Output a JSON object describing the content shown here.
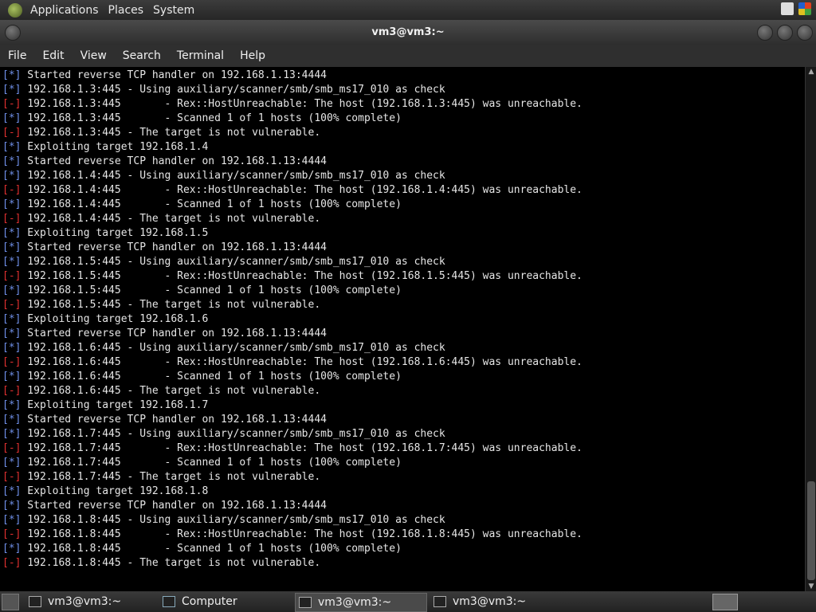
{
  "panel": {
    "menus": [
      "Applications",
      "Places",
      "System"
    ]
  },
  "window": {
    "title": "vm3@vm3:~"
  },
  "menubar": {
    "items": [
      "File",
      "Edit",
      "View",
      "Search",
      "Terminal",
      "Help"
    ]
  },
  "terminal": {
    "lines": [
      {
        "tag": "[*]",
        "text": " Started reverse TCP handler on 192.168.1.13:4444"
      },
      {
        "tag": "[*]",
        "text": " 192.168.1.3:445 - Using auxiliary/scanner/smb/smb_ms17_010 as check"
      },
      {
        "tag": "[-]",
        "text": " 192.168.1.3:445       - Rex::HostUnreachable: The host (192.168.1.3:445) was unreachable."
      },
      {
        "tag": "[*]",
        "text": " 192.168.1.3:445       - Scanned 1 of 1 hosts (100% complete)"
      },
      {
        "tag": "[-]",
        "text": " 192.168.1.3:445 - The target is not vulnerable."
      },
      {
        "tag": "[*]",
        "text": " Exploiting target 192.168.1.4"
      },
      {
        "tag": "[*]",
        "text": " Started reverse TCP handler on 192.168.1.13:4444"
      },
      {
        "tag": "[*]",
        "text": " 192.168.1.4:445 - Using auxiliary/scanner/smb/smb_ms17_010 as check"
      },
      {
        "tag": "[-]",
        "text": " 192.168.1.4:445       - Rex::HostUnreachable: The host (192.168.1.4:445) was unreachable."
      },
      {
        "tag": "[*]",
        "text": " 192.168.1.4:445       - Scanned 1 of 1 hosts (100% complete)"
      },
      {
        "tag": "[-]",
        "text": " 192.168.1.4:445 - The target is not vulnerable."
      },
      {
        "tag": "[*]",
        "text": " Exploiting target 192.168.1.5"
      },
      {
        "tag": "[*]",
        "text": " Started reverse TCP handler on 192.168.1.13:4444"
      },
      {
        "tag": "[*]",
        "text": " 192.168.1.5:445 - Using auxiliary/scanner/smb/smb_ms17_010 as check"
      },
      {
        "tag": "[-]",
        "text": " 192.168.1.5:445       - Rex::HostUnreachable: The host (192.168.1.5:445) was unreachable."
      },
      {
        "tag": "[*]",
        "text": " 192.168.1.5:445       - Scanned 1 of 1 hosts (100% complete)"
      },
      {
        "tag": "[-]",
        "text": " 192.168.1.5:445 - The target is not vulnerable."
      },
      {
        "tag": "[*]",
        "text": " Exploiting target 192.168.1.6"
      },
      {
        "tag": "[*]",
        "text": " Started reverse TCP handler on 192.168.1.13:4444"
      },
      {
        "tag": "[*]",
        "text": " 192.168.1.6:445 - Using auxiliary/scanner/smb/smb_ms17_010 as check"
      },
      {
        "tag": "[-]",
        "text": " 192.168.1.6:445       - Rex::HostUnreachable: The host (192.168.1.6:445) was unreachable."
      },
      {
        "tag": "[*]",
        "text": " 192.168.1.6:445       - Scanned 1 of 1 hosts (100% complete)"
      },
      {
        "tag": "[-]",
        "text": " 192.168.1.6:445 - The target is not vulnerable."
      },
      {
        "tag": "[*]",
        "text": " Exploiting target 192.168.1.7"
      },
      {
        "tag": "[*]",
        "text": " Started reverse TCP handler on 192.168.1.13:4444"
      },
      {
        "tag": "[*]",
        "text": " 192.168.1.7:445 - Using auxiliary/scanner/smb/smb_ms17_010 as check"
      },
      {
        "tag": "[-]",
        "text": " 192.168.1.7:445       - Rex::HostUnreachable: The host (192.168.1.7:445) was unreachable."
      },
      {
        "tag": "[*]",
        "text": " 192.168.1.7:445       - Scanned 1 of 1 hosts (100% complete)"
      },
      {
        "tag": "[-]",
        "text": " 192.168.1.7:445 - The target is not vulnerable."
      },
      {
        "tag": "[*]",
        "text": " Exploiting target 192.168.1.8"
      },
      {
        "tag": "[*]",
        "text": " Started reverse TCP handler on 192.168.1.13:4444"
      },
      {
        "tag": "[*]",
        "text": " 192.168.1.8:445 - Using auxiliary/scanner/smb/smb_ms17_010 as check"
      },
      {
        "tag": "[-]",
        "text": " 192.168.1.8:445       - Rex::HostUnreachable: The host (192.168.1.8:445) was unreachable."
      },
      {
        "tag": "[*]",
        "text": " 192.168.1.8:445       - Scanned 1 of 1 hosts (100% complete)"
      },
      {
        "tag": "[-]",
        "text": " 192.168.1.8:445 - The target is not vulnerable."
      }
    ],
    "colors": {
      "info_tag": "#6f8fe8",
      "error_tag": "#e03030",
      "text": "#e6e6e6",
      "background": "#000000"
    }
  },
  "taskbar": {
    "tasks": [
      {
        "label": "vm3@vm3:~",
        "icon": "terminal-icon",
        "active": false
      },
      {
        "label": "Computer",
        "icon": "computer-icon",
        "active": false
      },
      {
        "label": "vm3@vm3:~",
        "icon": "terminal-icon",
        "active": true
      },
      {
        "label": "vm3@vm3:~",
        "icon": "terminal-icon",
        "active": false
      }
    ]
  }
}
